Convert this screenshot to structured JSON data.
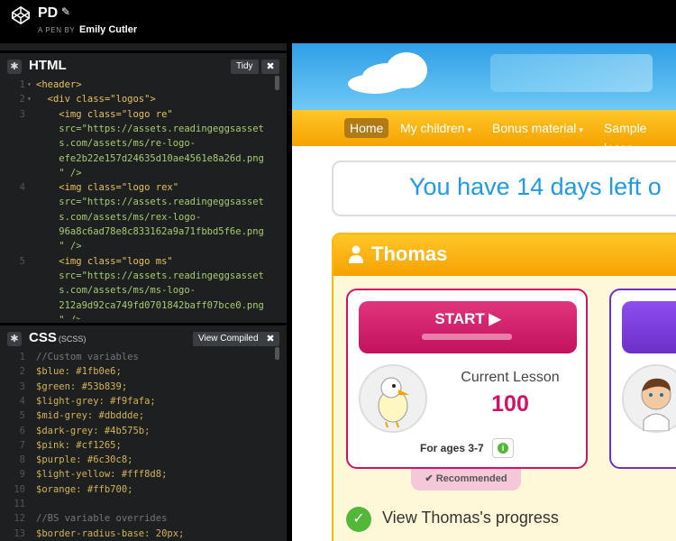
{
  "header": {
    "title": "PD",
    "byline_prefix": "A PEN BY",
    "author": "Emily Cutler"
  },
  "html_panel": {
    "title": "HTML",
    "tidy_label": "Tidy",
    "lines": [
      {
        "n": "1",
        "t": "<header>"
      },
      {
        "n": "2",
        "t": "  <div class=\"logos\">"
      },
      {
        "n": "3",
        "t": "    <img class=\"logo re\""
      },
      {
        "n": "",
        "t": "    src=\"https://assets.readingeggsasset"
      },
      {
        "n": "",
        "t": "    s.com/assets/ms/re-logo-"
      },
      {
        "n": "",
        "t": "    efe2b22e157d24635d10ae4561e8a26d.png"
      },
      {
        "n": "",
        "t": "    \" />"
      },
      {
        "n": "4",
        "t": "    <img class=\"logo rex\""
      },
      {
        "n": "",
        "t": "    src=\"https://assets.readingeggsasset"
      },
      {
        "n": "",
        "t": "    s.com/assets/ms/rex-logo-"
      },
      {
        "n": "",
        "t": "    96a8c6ad78e8c833162a9a71fbbd5f6e.png"
      },
      {
        "n": "",
        "t": "    \" />"
      },
      {
        "n": "5",
        "t": "    <img class=\"logo ms\""
      },
      {
        "n": "",
        "t": "    src=\"https://assets.readingeggsasset"
      },
      {
        "n": "",
        "t": "    s.com/assets/ms/ms-logo-"
      },
      {
        "n": "",
        "t": "    212a9d92ca749fd0701842baff07bce0.png"
      },
      {
        "n": "",
        "t": "    \" />"
      }
    ]
  },
  "css_panel": {
    "title": "CSS",
    "subtitle": "(SCSS)",
    "compiled_label": "View Compiled",
    "lines": [
      {
        "n": "1",
        "t": "//Custom variables"
      },
      {
        "n": "2",
        "t": "$blue: #1fb0e6;"
      },
      {
        "n": "3",
        "t": "$green: #53b839;"
      },
      {
        "n": "4",
        "t": "$light-grey: #f9fafa;"
      },
      {
        "n": "5",
        "t": "$mid-grey: #dbddde;"
      },
      {
        "n": "6",
        "t": "$dark-grey: #4b575b;"
      },
      {
        "n": "7",
        "t": "$pink: #cf1265;"
      },
      {
        "n": "8",
        "t": "$purple: #6c30c8;"
      },
      {
        "n": "9",
        "t": "$light-yellow: #fff8d8;"
      },
      {
        "n": "10",
        "t": "$orange: #ffb700;"
      },
      {
        "n": "11",
        "t": ""
      },
      {
        "n": "12",
        "t": "//BS variable overrides"
      },
      {
        "n": "13",
        "t": "$border-radius-base: 20px;"
      }
    ]
  },
  "preview": {
    "nav": [
      "Home",
      "My children",
      "Bonus material",
      "Sample lesso"
    ],
    "trial_text": "You have 14 days left o",
    "child_name": "Thomas",
    "start_label": "START",
    "current_lesson_label": "Current Lesson",
    "current_lesson_number": "100",
    "ages_label": "For ages 3-7",
    "info_icon_char": "i",
    "recommended_label": "Recommended",
    "progress_label": "View Thomas's progress"
  },
  "colors": {
    "pink": "#cf1265",
    "purple": "#6c30c8",
    "orange": "#ffb700",
    "green": "#53b839",
    "blue": "#1fb0e6",
    "light_yellow": "#fff8d8"
  }
}
